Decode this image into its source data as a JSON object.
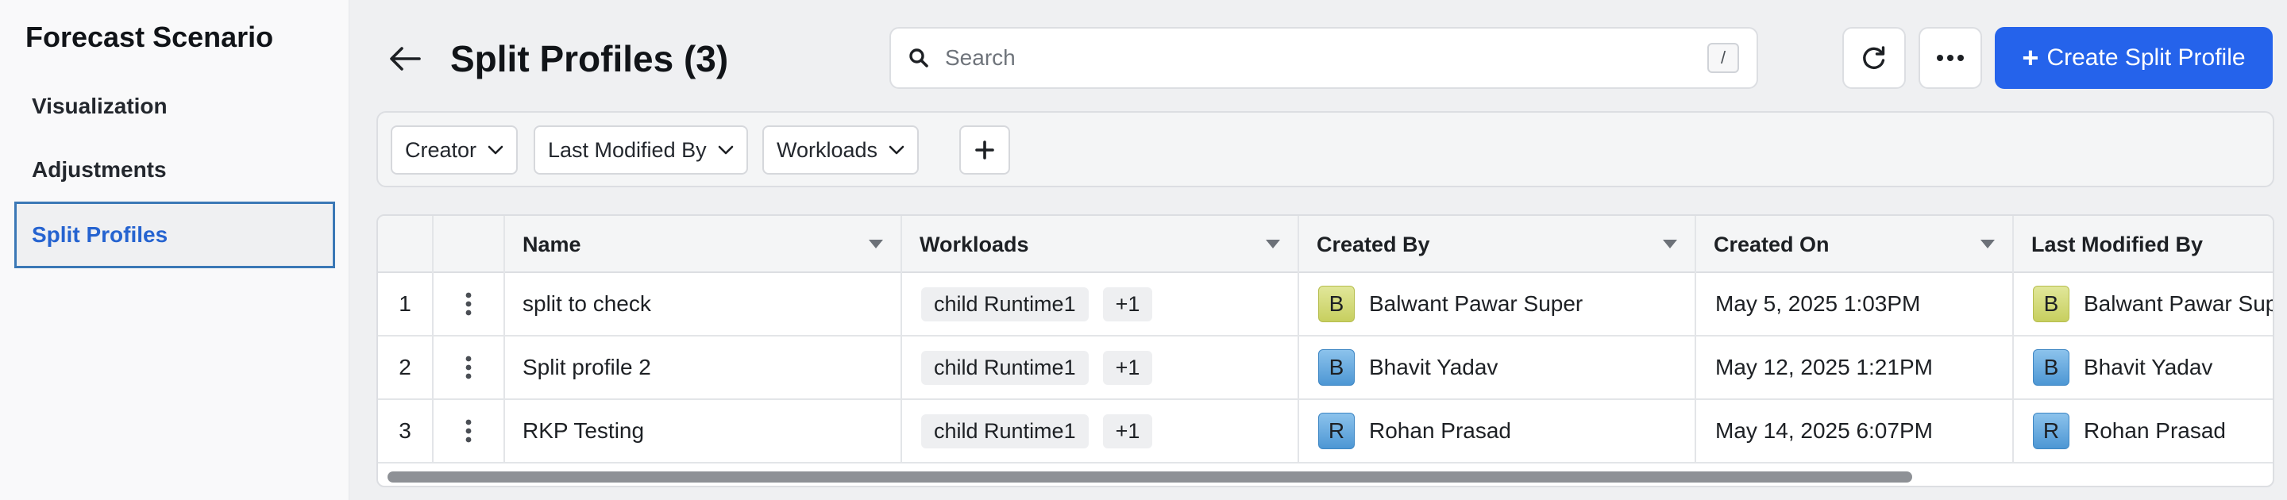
{
  "sidebar": {
    "title": "Forecast Scenario",
    "items": [
      {
        "label": "Visualization",
        "active": false
      },
      {
        "label": "Adjustments",
        "active": false
      },
      {
        "label": "Split Profiles",
        "active": true
      }
    ]
  },
  "header": {
    "title": "Split Profiles (3)",
    "search_placeholder": "Search",
    "search_shortcut": "/",
    "create_label": "Create Split Profile",
    "create_plus": "+"
  },
  "filters": [
    "Creator",
    "Last Modified By",
    "Workloads"
  ],
  "table": {
    "columns": [
      "Name",
      "Workloads",
      "Created By",
      "Created On",
      "Last Modified By"
    ],
    "rows": [
      {
        "index": "1",
        "name": "split to check",
        "workload": "child Runtime1",
        "extra": "+1",
        "created_by": "Balwant Pawar Super",
        "created_by_initial": "B",
        "created_on": "May 5, 2025 1:03PM",
        "modified_by": "Balwant Pawar Super",
        "modified_by_initial": "B",
        "avatar_color": "yellow"
      },
      {
        "index": "2",
        "name": "Split profile 2",
        "workload": "child Runtime1",
        "extra": "+1",
        "created_by": "Bhavit Yadav",
        "created_by_initial": "B",
        "created_on": "May 12, 2025 1:21PM",
        "modified_by": "Bhavit Yadav",
        "modified_by_initial": "B",
        "avatar_color": "blue"
      },
      {
        "index": "3",
        "name": "RKP Testing",
        "workload": "child Runtime1",
        "extra": "+1",
        "created_by": "Rohan Prasad",
        "created_by_initial": "R",
        "created_on": "May 14, 2025 6:07PM",
        "modified_by": "Rohan Prasad",
        "modified_by_initial": "R",
        "avatar_color": "blue"
      }
    ]
  },
  "colors": {
    "accent": "#2563eb",
    "active_nav": "#2563d0",
    "avatar_yellow": "#d6dc7a",
    "avatar_blue": "#5fa5dc"
  },
  "icons": {
    "back": "arrow-left-icon",
    "search": "search-icon",
    "refresh": "refresh-icon",
    "more": "more-horizontal-icon",
    "add": "plus-icon",
    "row_menu": "more-vertical-icon",
    "sort": "sort-caret-icon",
    "dropdown": "chevron-down-icon"
  }
}
